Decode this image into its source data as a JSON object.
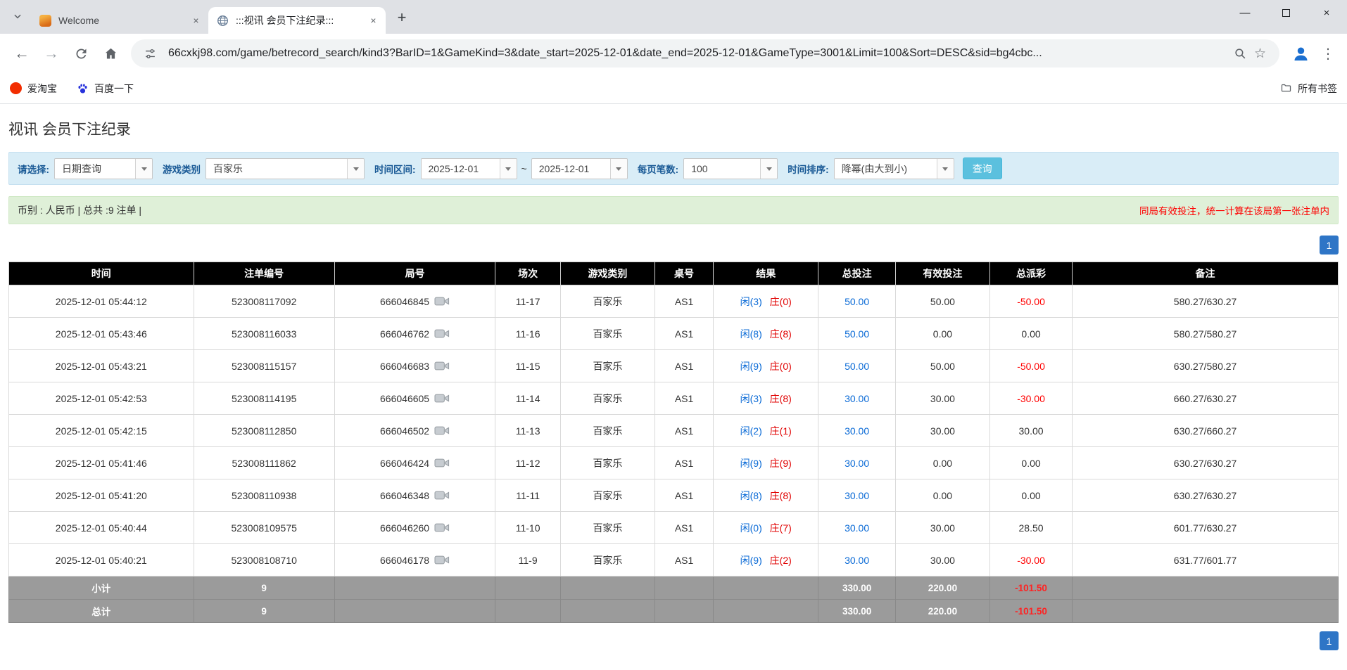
{
  "browser": {
    "tabs": [
      {
        "title": "Welcome"
      },
      {
        "title": ":::视讯 会员下注纪录:::"
      }
    ],
    "url": "66cxkj98.com/game/betrecord_search/kind3?BarID=1&GameKind=3&date_start=2025-12-01&date_end=2025-12-01&GameType=3001&Limit=100&Sort=DESC&sid=bg4cbc...",
    "bookmarks": [
      {
        "label": "爱淘宝"
      },
      {
        "label": "百度一下"
      }
    ],
    "bookmarks_right": "所有书签"
  },
  "icons": {
    "tab_close": "×",
    "new_tab": "+",
    "minimize": "—",
    "close": "×",
    "back": "←",
    "forward": "→",
    "star": "☆",
    "menu": "⋮"
  },
  "colors": {
    "accent_blue": "#2e75c6",
    "search_button_cyan": "#5bc0de",
    "filter_bar_bg": "#d9edf7",
    "info_bar_bg": "#dff0d8",
    "table_header_bg": "#000000",
    "summary_row_bg": "#9b9b9b",
    "link_blue": "#0a6ad6",
    "banker_red": "#e00000",
    "negative_red": "#ff0000"
  },
  "page": {
    "title": "视讯 会员下注纪录",
    "filters": {
      "select_label": "请选择:",
      "select_value": "日期查询",
      "game_type_label": "游戏类别",
      "game_type_value": "百家乐",
      "date_range_label": "时间区间:",
      "date_start": "2025-12-01",
      "date_tilde": "~",
      "date_end": "2025-12-01",
      "per_page_label": "每页笔数:",
      "per_page_value": "100",
      "sort_label": "时间排序:",
      "sort_value": "降幂(由大到小)",
      "search_button": "查询"
    },
    "info_bar": {
      "left": "币别 : 人民币 | 总共 :9 注单 |",
      "right": "同局有效投注，统一计算在该局第一张注单内"
    },
    "pagination": "1",
    "table": {
      "headers": [
        "时间",
        "注单编号",
        "局号",
        "场次",
        "游戏类别",
        "桌号",
        "结果",
        "总投注",
        "有效投注",
        "总派彩",
        "备注"
      ],
      "rows": [
        {
          "time": "2025-12-01 05:44:12",
          "bet_id": "523008117092",
          "round": "666046845",
          "session": "11-17",
          "game": "百家乐",
          "table": "AS1",
          "player": "闲(3)",
          "banker": "庄(0)",
          "total_bet": "50.00",
          "valid_bet": "50.00",
          "payout": "-50.00",
          "note": "580.27/630.27"
        },
        {
          "time": "2025-12-01 05:43:46",
          "bet_id": "523008116033",
          "round": "666046762",
          "session": "11-16",
          "game": "百家乐",
          "table": "AS1",
          "player": "闲(8)",
          "banker": "庄(8)",
          "total_bet": "50.00",
          "valid_bet": "0.00",
          "payout": "0.00",
          "note": "580.27/580.27"
        },
        {
          "time": "2025-12-01 05:43:21",
          "bet_id": "523008115157",
          "round": "666046683",
          "session": "11-15",
          "game": "百家乐",
          "table": "AS1",
          "player": "闲(9)",
          "banker": "庄(0)",
          "total_bet": "50.00",
          "valid_bet": "50.00",
          "payout": "-50.00",
          "note": "630.27/580.27"
        },
        {
          "time": "2025-12-01 05:42:53",
          "bet_id": "523008114195",
          "round": "666046605",
          "session": "11-14",
          "game": "百家乐",
          "table": "AS1",
          "player": "闲(3)",
          "banker": "庄(8)",
          "total_bet": "30.00",
          "valid_bet": "30.00",
          "payout": "-30.00",
          "note": "660.27/630.27"
        },
        {
          "time": "2025-12-01 05:42:15",
          "bet_id": "523008112850",
          "round": "666046502",
          "session": "11-13",
          "game": "百家乐",
          "table": "AS1",
          "player": "闲(2)",
          "banker": "庄(1)",
          "total_bet": "30.00",
          "valid_bet": "30.00",
          "payout": "30.00",
          "note": "630.27/660.27"
        },
        {
          "time": "2025-12-01 05:41:46",
          "bet_id": "523008111862",
          "round": "666046424",
          "session": "11-12",
          "game": "百家乐",
          "table": "AS1",
          "player": "闲(9)",
          "banker": "庄(9)",
          "total_bet": "30.00",
          "valid_bet": "0.00",
          "payout": "0.00",
          "note": "630.27/630.27"
        },
        {
          "time": "2025-12-01 05:41:20",
          "bet_id": "523008110938",
          "round": "666046348",
          "session": "11-11",
          "game": "百家乐",
          "table": "AS1",
          "player": "闲(8)",
          "banker": "庄(8)",
          "total_bet": "30.00",
          "valid_bet": "0.00",
          "payout": "0.00",
          "note": "630.27/630.27"
        },
        {
          "time": "2025-12-01 05:40:44",
          "bet_id": "523008109575",
          "round": "666046260",
          "session": "11-10",
          "game": "百家乐",
          "table": "AS1",
          "player": "闲(0)",
          "banker": "庄(7)",
          "total_bet": "30.00",
          "valid_bet": "30.00",
          "payout": "28.50",
          "note": "601.77/630.27"
        },
        {
          "time": "2025-12-01 05:40:21",
          "bet_id": "523008108710",
          "round": "666046178",
          "session": "11-9",
          "game": "百家乐",
          "table": "AS1",
          "player": "闲(9)",
          "banker": "庄(2)",
          "total_bet": "30.00",
          "valid_bet": "30.00",
          "payout": "-30.00",
          "note": "631.77/601.77"
        }
      ],
      "subtotal": {
        "label": "小计",
        "count": "9",
        "total_bet": "330.00",
        "valid_bet": "220.00",
        "payout": "-101.50"
      },
      "total": {
        "label": "总计",
        "count": "9",
        "total_bet": "330.00",
        "valid_bet": "220.00",
        "payout": "-101.50"
      }
    }
  }
}
